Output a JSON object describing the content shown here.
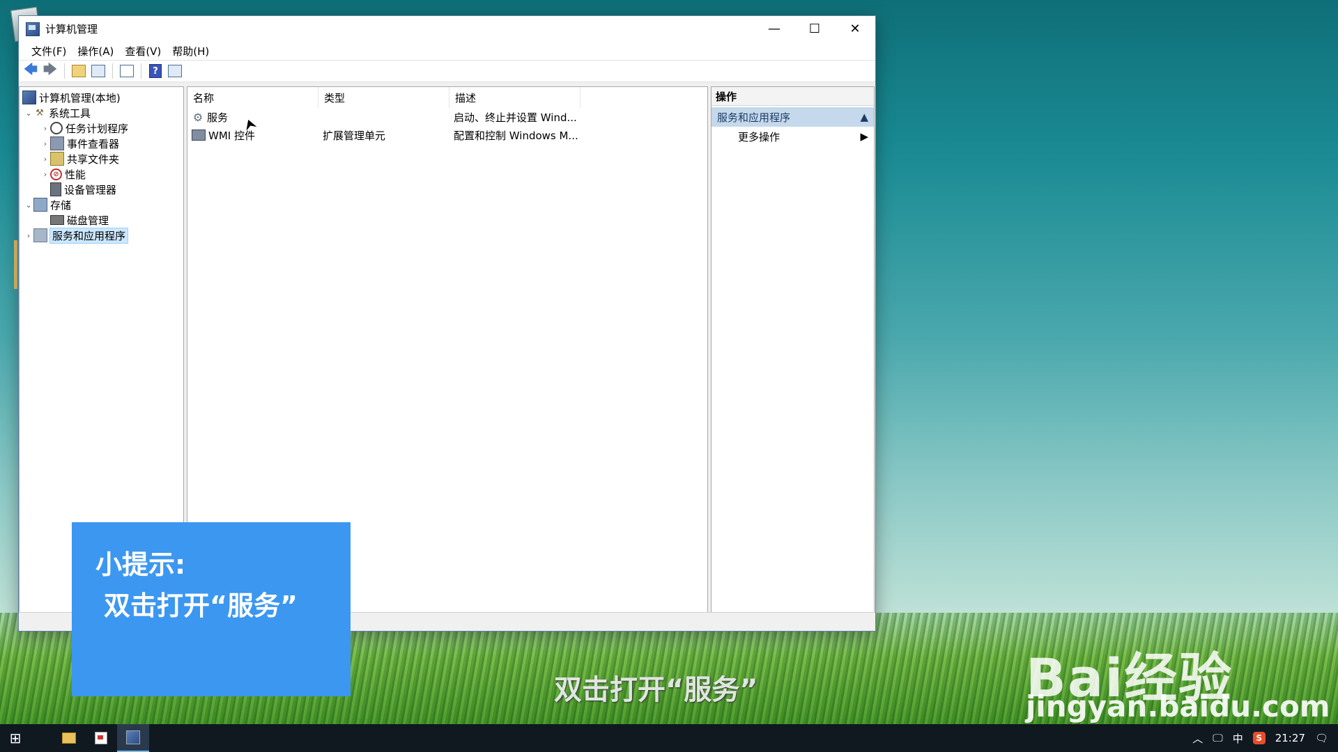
{
  "window": {
    "title": "计算机管理",
    "controls": {
      "minimize": "—",
      "maximize": "☐",
      "close": "✕"
    }
  },
  "menu": [
    "文件(F)",
    "操作(A)",
    "查看(V)",
    "帮助(H)"
  ],
  "tree": {
    "root": "计算机管理(本地)",
    "system_tools": "系统工具",
    "task_scheduler": "任务计划程序",
    "event_viewer": "事件查看器",
    "shared_folders": "共享文件夹",
    "performance": "性能",
    "device_manager": "设备管理器",
    "storage": "存储",
    "disk_management": "磁盘管理",
    "services_apps": "服务和应用程序"
  },
  "list": {
    "headers": {
      "name": "名称",
      "type": "类型",
      "desc": "描述"
    },
    "rows": [
      {
        "name": "服务",
        "type": "",
        "desc": "启动、终止并设置 Wind..."
      },
      {
        "name": "WMI 控件",
        "type": "扩展管理单元",
        "desc": "配置和控制 Windows M..."
      }
    ]
  },
  "actions": {
    "title": "操作",
    "section": "服务和应用程序",
    "more": "更多操作"
  },
  "tip": {
    "title": "小提示:",
    "body": "双击打开“服务”"
  },
  "subtitle": "双击打开“服务”",
  "watermark": {
    "brand": "Bai经验",
    "url": "jingyan.baidu.com"
  },
  "taskbar": {
    "ime": "中",
    "s_badge": "S",
    "time": "21:27"
  },
  "colors": {
    "tip_bg": "#3c97f0",
    "selection": "#cce8ff",
    "action_header": "#c5d8ec"
  }
}
